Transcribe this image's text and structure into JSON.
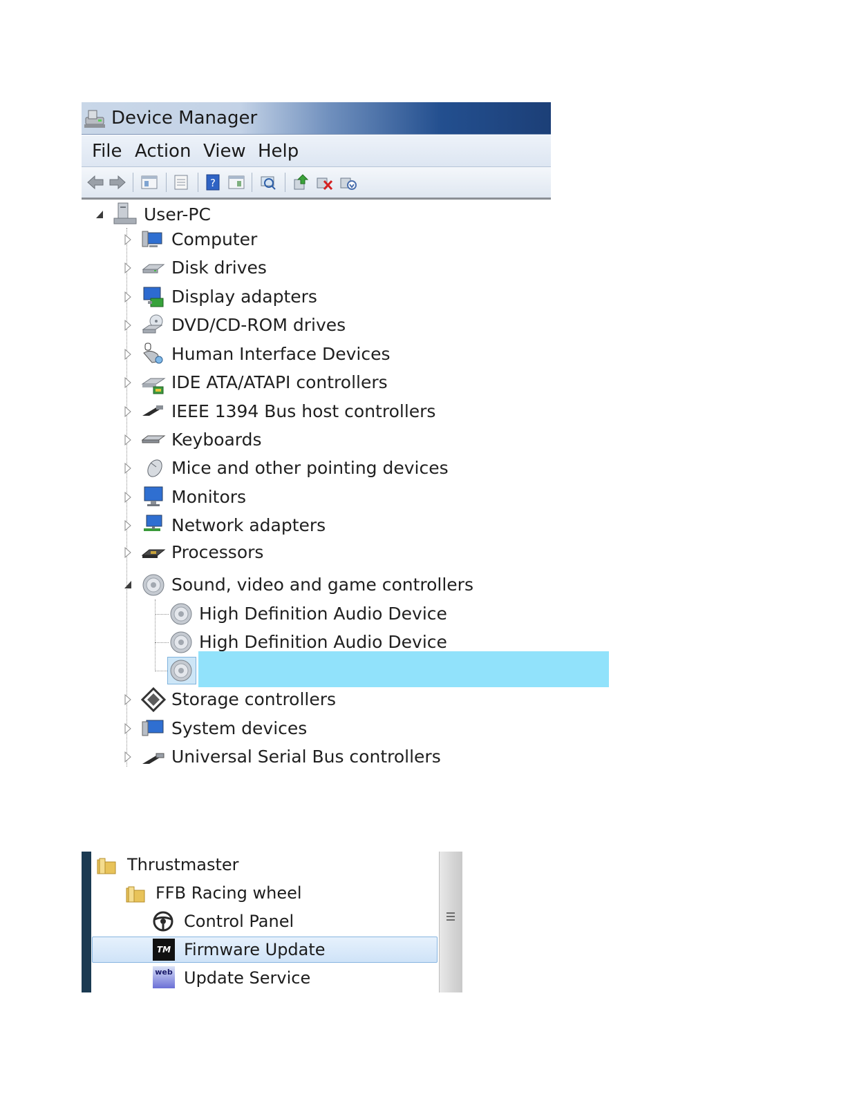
{
  "device_manager": {
    "title": "Device Manager",
    "menu": [
      "File",
      "Action",
      "View",
      "Help"
    ],
    "toolbar_icons": [
      "back-arrow-icon",
      "forward-arrow-icon",
      "show-hide-tree-icon",
      "properties-icon",
      "help-icon",
      "view-icon",
      "scan-hardware-icon",
      "update-driver-icon",
      "disable-device-icon",
      "uninstall-icon"
    ],
    "root": "User-PC",
    "categories": [
      "Computer",
      "Disk drives",
      "Display adapters",
      "DVD/CD-ROM drives",
      "Human Interface Devices",
      "IDE ATA/ATAPI controllers",
      "IEEE 1394 Bus host controllers",
      "Keyboards",
      "Mice and other pointing devices",
      "Monitors",
      "Network adapters",
      "Processors",
      "Sound, video and game controllers",
      "Storage controllers",
      "System devices",
      "Universal Serial Bus controllers"
    ],
    "sound_children": [
      "High Definition Audio Device",
      "High Definition Audio Device",
      ""
    ],
    "selection_color": "#91e2fb"
  },
  "start_menu": {
    "items": [
      "Thrustmaster",
      "FFB Racing wheel",
      "Control Panel",
      "Firmware Update",
      "Update Service"
    ],
    "tm_logo_text": "TM",
    "web_logo_text": "web"
  }
}
